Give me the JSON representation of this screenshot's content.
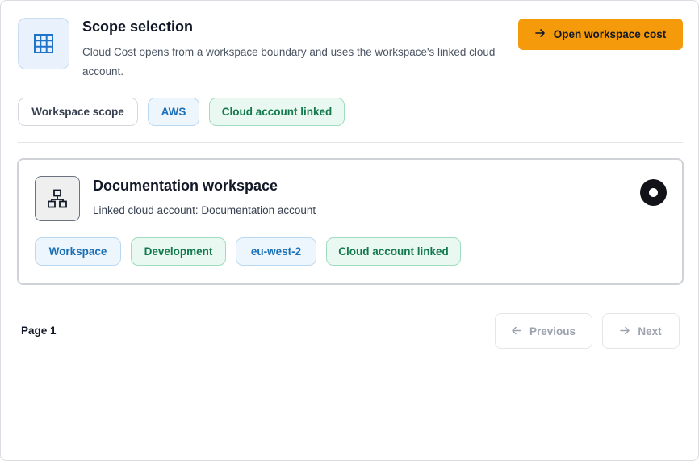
{
  "header": {
    "title": "Scope selection",
    "description": "Cloud Cost opens from a workspace boundary and uses the workspace's linked cloud account.",
    "icon": "grid-icon",
    "primary_button": {
      "label": "Open workspace cost",
      "icon": "arrow-right-icon"
    }
  },
  "scope_chips": [
    {
      "label": "Workspace scope"
    },
    {
      "label": "AWS"
    },
    {
      "label": "Cloud account linked"
    }
  ],
  "workspace_card": {
    "title": "Documentation workspace",
    "subtitle": "Linked cloud account: Documentation account",
    "icon": "network-icon",
    "selected": true,
    "tags": [
      {
        "label": "Workspace"
      },
      {
        "label": "Development"
      },
      {
        "label": "eu-west-2"
      },
      {
        "label": "Cloud account linked"
      }
    ]
  },
  "pagination": {
    "page_label": "Page 1",
    "previous_label": "Previous",
    "next_label": "Next"
  },
  "colors": {
    "accent": "#f59b0b",
    "chip_blue": "#1b6fb5",
    "chip_green": "#13794d"
  }
}
